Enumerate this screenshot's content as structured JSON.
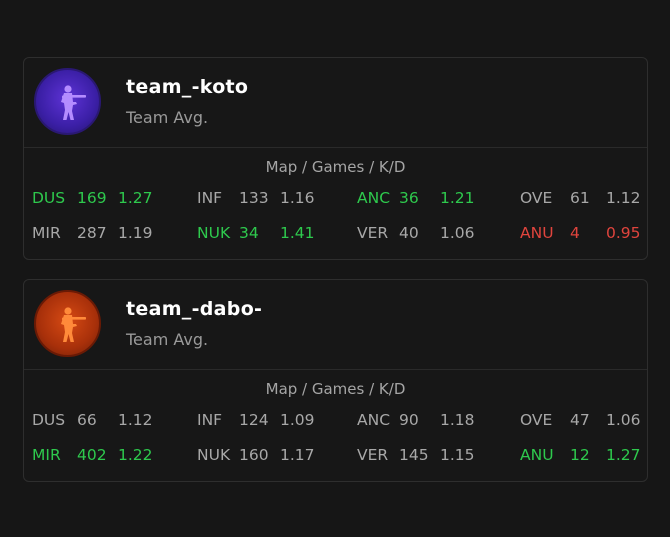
{
  "teams": [
    {
      "name": "team_-koto",
      "subtitle": "Team Avg.",
      "avatar_color": "#4a28c0",
      "stats_header": "Map / Games / K/D",
      "rows": [
        [
          {
            "map": "DUS",
            "games": "169",
            "kd": "1.27",
            "status": "green"
          },
          {
            "map": "INF",
            "games": "133",
            "kd": "1.16",
            "status": "neutral"
          },
          {
            "map": "ANC",
            "games": "36",
            "kd": "1.21",
            "status": "green"
          },
          {
            "map": "OVE",
            "games": "61",
            "kd": "1.12",
            "status": "neutral"
          }
        ],
        [
          {
            "map": "MIR",
            "games": "287",
            "kd": "1.19",
            "status": "neutral"
          },
          {
            "map": "NUK",
            "games": "34",
            "kd": "1.41",
            "status": "green"
          },
          {
            "map": "VER",
            "games": "40",
            "kd": "1.06",
            "status": "neutral"
          },
          {
            "map": "ANU",
            "games": "4",
            "kd": "0.95",
            "status": "red"
          }
        ]
      ]
    },
    {
      "name": "team_-dabo-",
      "subtitle": "Team Avg.",
      "avatar_color": "#c03a0c",
      "stats_header": "Map / Games / K/D",
      "rows": [
        [
          {
            "map": "DUS",
            "games": "66",
            "kd": "1.12",
            "status": "neutral"
          },
          {
            "map": "INF",
            "games": "124",
            "kd": "1.09",
            "status": "neutral"
          },
          {
            "map": "ANC",
            "games": "90",
            "kd": "1.18",
            "status": "neutral"
          },
          {
            "map": "OVE",
            "games": "47",
            "kd": "1.06",
            "status": "neutral"
          }
        ],
        [
          {
            "map": "MIR",
            "games": "402",
            "kd": "1.22",
            "status": "green"
          },
          {
            "map": "NUK",
            "games": "160",
            "kd": "1.17",
            "status": "neutral"
          },
          {
            "map": "VER",
            "games": "145",
            "kd": "1.15",
            "status": "neutral"
          },
          {
            "map": "ANU",
            "games": "12",
            "kd": "1.27",
            "status": "green"
          }
        ]
      ]
    }
  ],
  "colors": {
    "green": "#2ec94d",
    "red": "#e0443d",
    "neutral": "#a8a8a8"
  },
  "icons": {
    "avatar": "soldier-silhouette-icon"
  }
}
